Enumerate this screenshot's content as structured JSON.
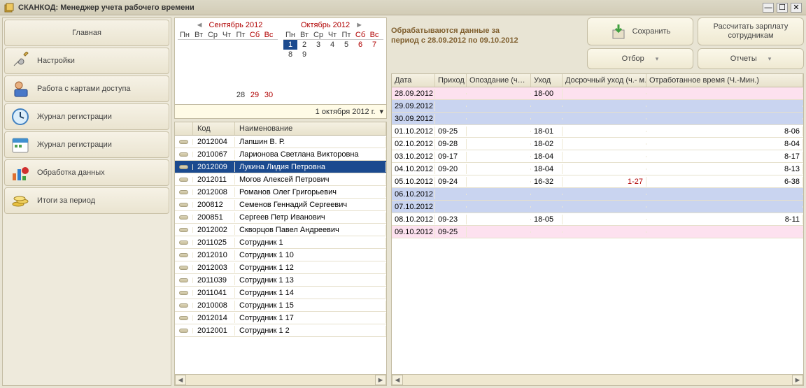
{
  "title": "СКАНКОД: Менеджер учета рабочего времени",
  "sidebar": {
    "main": "Главная",
    "settings": "Настройки",
    "cards": "Работа с картами доступа",
    "journal": "Журнал регистрации",
    "processing": "Обработка данных",
    "totals": "Итоги за период"
  },
  "cal1": {
    "title": "Сентябрь 2012",
    "days": [
      "Пн",
      "Вт",
      "Ср",
      "Чт",
      "Пт",
      "Сб",
      "Вс"
    ],
    "lastrow": [
      "",
      "",
      "",
      "",
      "28",
      "29",
      "30"
    ]
  },
  "cal2": {
    "title": "Октябрь 2012",
    "days": [
      "Пн",
      "Вт",
      "Ср",
      "Чт",
      "Пт",
      "Сб",
      "Вс"
    ],
    "r1": [
      "1",
      "2",
      "3",
      "4",
      "5",
      "6",
      "7"
    ],
    "r2": [
      "8",
      "9",
      "",
      "",
      "",
      "",
      ""
    ]
  },
  "datebar": "1 октября 2012 г.",
  "empcols": {
    "code": "Код",
    "name": "Наименование"
  },
  "employees": [
    {
      "code": "2012004",
      "name": "Лапшин В. Р."
    },
    {
      "code": "2010067",
      "name": "Ларионова Светлана Викторовна"
    },
    {
      "code": "2012009",
      "name": "Лукина  Лидия Петровна"
    },
    {
      "code": "2012011",
      "name": "Могов Алексей Петрович"
    },
    {
      "code": "2012008",
      "name": "Романов Олег Григорьевич"
    },
    {
      "code": "200812",
      "name": "Семенов Геннадий Сергеевич"
    },
    {
      "code": "200851",
      "name": "Сергеев Петр Иванович"
    },
    {
      "code": "2012002",
      "name": "Скворцов Павел Андреевич"
    },
    {
      "code": "2011025",
      "name": "Сотрудник 1"
    },
    {
      "code": "2012010",
      "name": "Сотрудник 1  10"
    },
    {
      "code": "2012003",
      "name": "Сотрудник 1  12"
    },
    {
      "code": "2011039",
      "name": "Сотрудник 1  13"
    },
    {
      "code": "2011041",
      "name": "Сотрудник 1  14"
    },
    {
      "code": "2010008",
      "name": "Сотрудник 1  15"
    },
    {
      "code": "2012014",
      "name": "Сотрудник 1  17"
    },
    {
      "code": "2012001",
      "name": "Сотрудник 1  2"
    }
  ],
  "period_msg_l1": "Обрабатываются данные за",
  "period_msg_l2": "период с 28.09.2012 по 09.10.2012",
  "buttons": {
    "save": "Сохранить",
    "calc": "Рассчитать зарплату сотрудникам",
    "filter": "Отбор",
    "reports": "Отчеты"
  },
  "tcols": {
    "date": "Дата",
    "in": "Приход",
    "late": "Опоздание (ч…",
    "out": "Уход",
    "early": "Досрочный уход (ч.- м…",
    "worked": "Отработанное время (Ч.-Мин.)"
  },
  "time": [
    {
      "d": "28.09.2012",
      "i": "",
      "l": "",
      "o": "18-00",
      "e": "",
      "w": "",
      "cls": "pink"
    },
    {
      "d": "29.09.2012",
      "i": "",
      "l": "",
      "o": "",
      "e": "",
      "w": "",
      "cls": "blue"
    },
    {
      "d": "30.09.2012",
      "i": "",
      "l": "",
      "o": "",
      "e": "",
      "w": "",
      "cls": "blue"
    },
    {
      "d": "01.10.2012",
      "i": "09-25",
      "l": "",
      "o": "18-01",
      "e": "",
      "w": "8-06",
      "cls": ""
    },
    {
      "d": "02.10.2012",
      "i": "09-28",
      "l": "",
      "o": "18-02",
      "e": "",
      "w": "8-04",
      "cls": ""
    },
    {
      "d": "03.10.2012",
      "i": "09-17",
      "l": "",
      "o": "18-04",
      "e": "",
      "w": "8-17",
      "cls": ""
    },
    {
      "d": "04.10.2012",
      "i": "09-20",
      "l": "",
      "o": "18-04",
      "e": "",
      "w": "8-13",
      "cls": ""
    },
    {
      "d": "05.10.2012",
      "i": "09-24",
      "l": "",
      "o": "16-32",
      "e": "1-27",
      "w": "6-38",
      "cls": ""
    },
    {
      "d": "06.10.2012",
      "i": "",
      "l": "",
      "o": "",
      "e": "",
      "w": "",
      "cls": "blue"
    },
    {
      "d": "07.10.2012",
      "i": "",
      "l": "",
      "o": "",
      "e": "",
      "w": "",
      "cls": "blue"
    },
    {
      "d": "08.10.2012",
      "i": "09-23",
      "l": "",
      "o": "18-05",
      "e": "",
      "w": "8-11",
      "cls": ""
    },
    {
      "d": "09.10.2012",
      "i": "09-25",
      "l": "",
      "o": "",
      "e": "",
      "w": "",
      "cls": "pink"
    }
  ]
}
